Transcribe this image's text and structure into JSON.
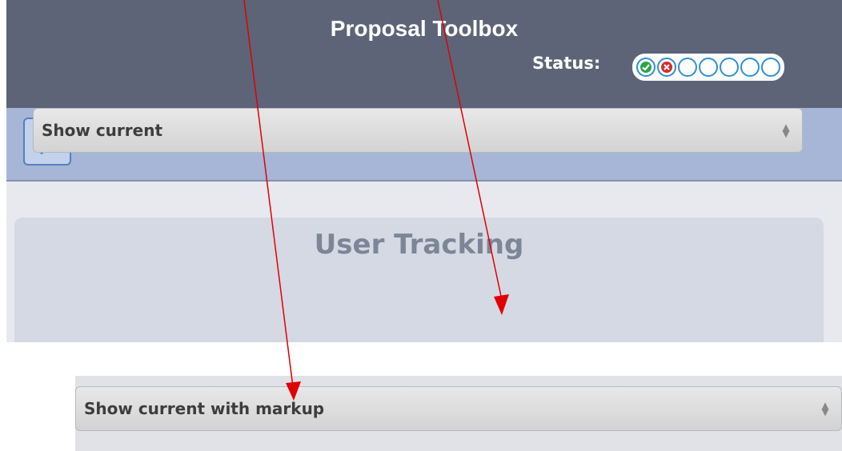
{
  "header": {
    "title": "Proposal Toolbox",
    "status_label": "Status:",
    "status_steps": [
      "done",
      "rejected",
      "pending",
      "pending",
      "pending",
      "pending",
      "pending"
    ]
  },
  "toolbar": {
    "icons": [
      "comment-icon",
      "list-icon",
      "pencil-icon",
      "add-document-icon",
      "checkmark-icon",
      "arrow-right-icon",
      "shuffle-icon"
    ],
    "active_index": 0
  },
  "user_tracking": {
    "title": "User Tracking",
    "select_value": "Show current"
  },
  "markup_select": {
    "select_value": "Show current with markup"
  },
  "colors": {
    "header_bg": "#5d6478",
    "toolbar_bg": "#a7b6d6",
    "accent_blue": "#2f8fd0",
    "arrow_red": "#e00000"
  }
}
